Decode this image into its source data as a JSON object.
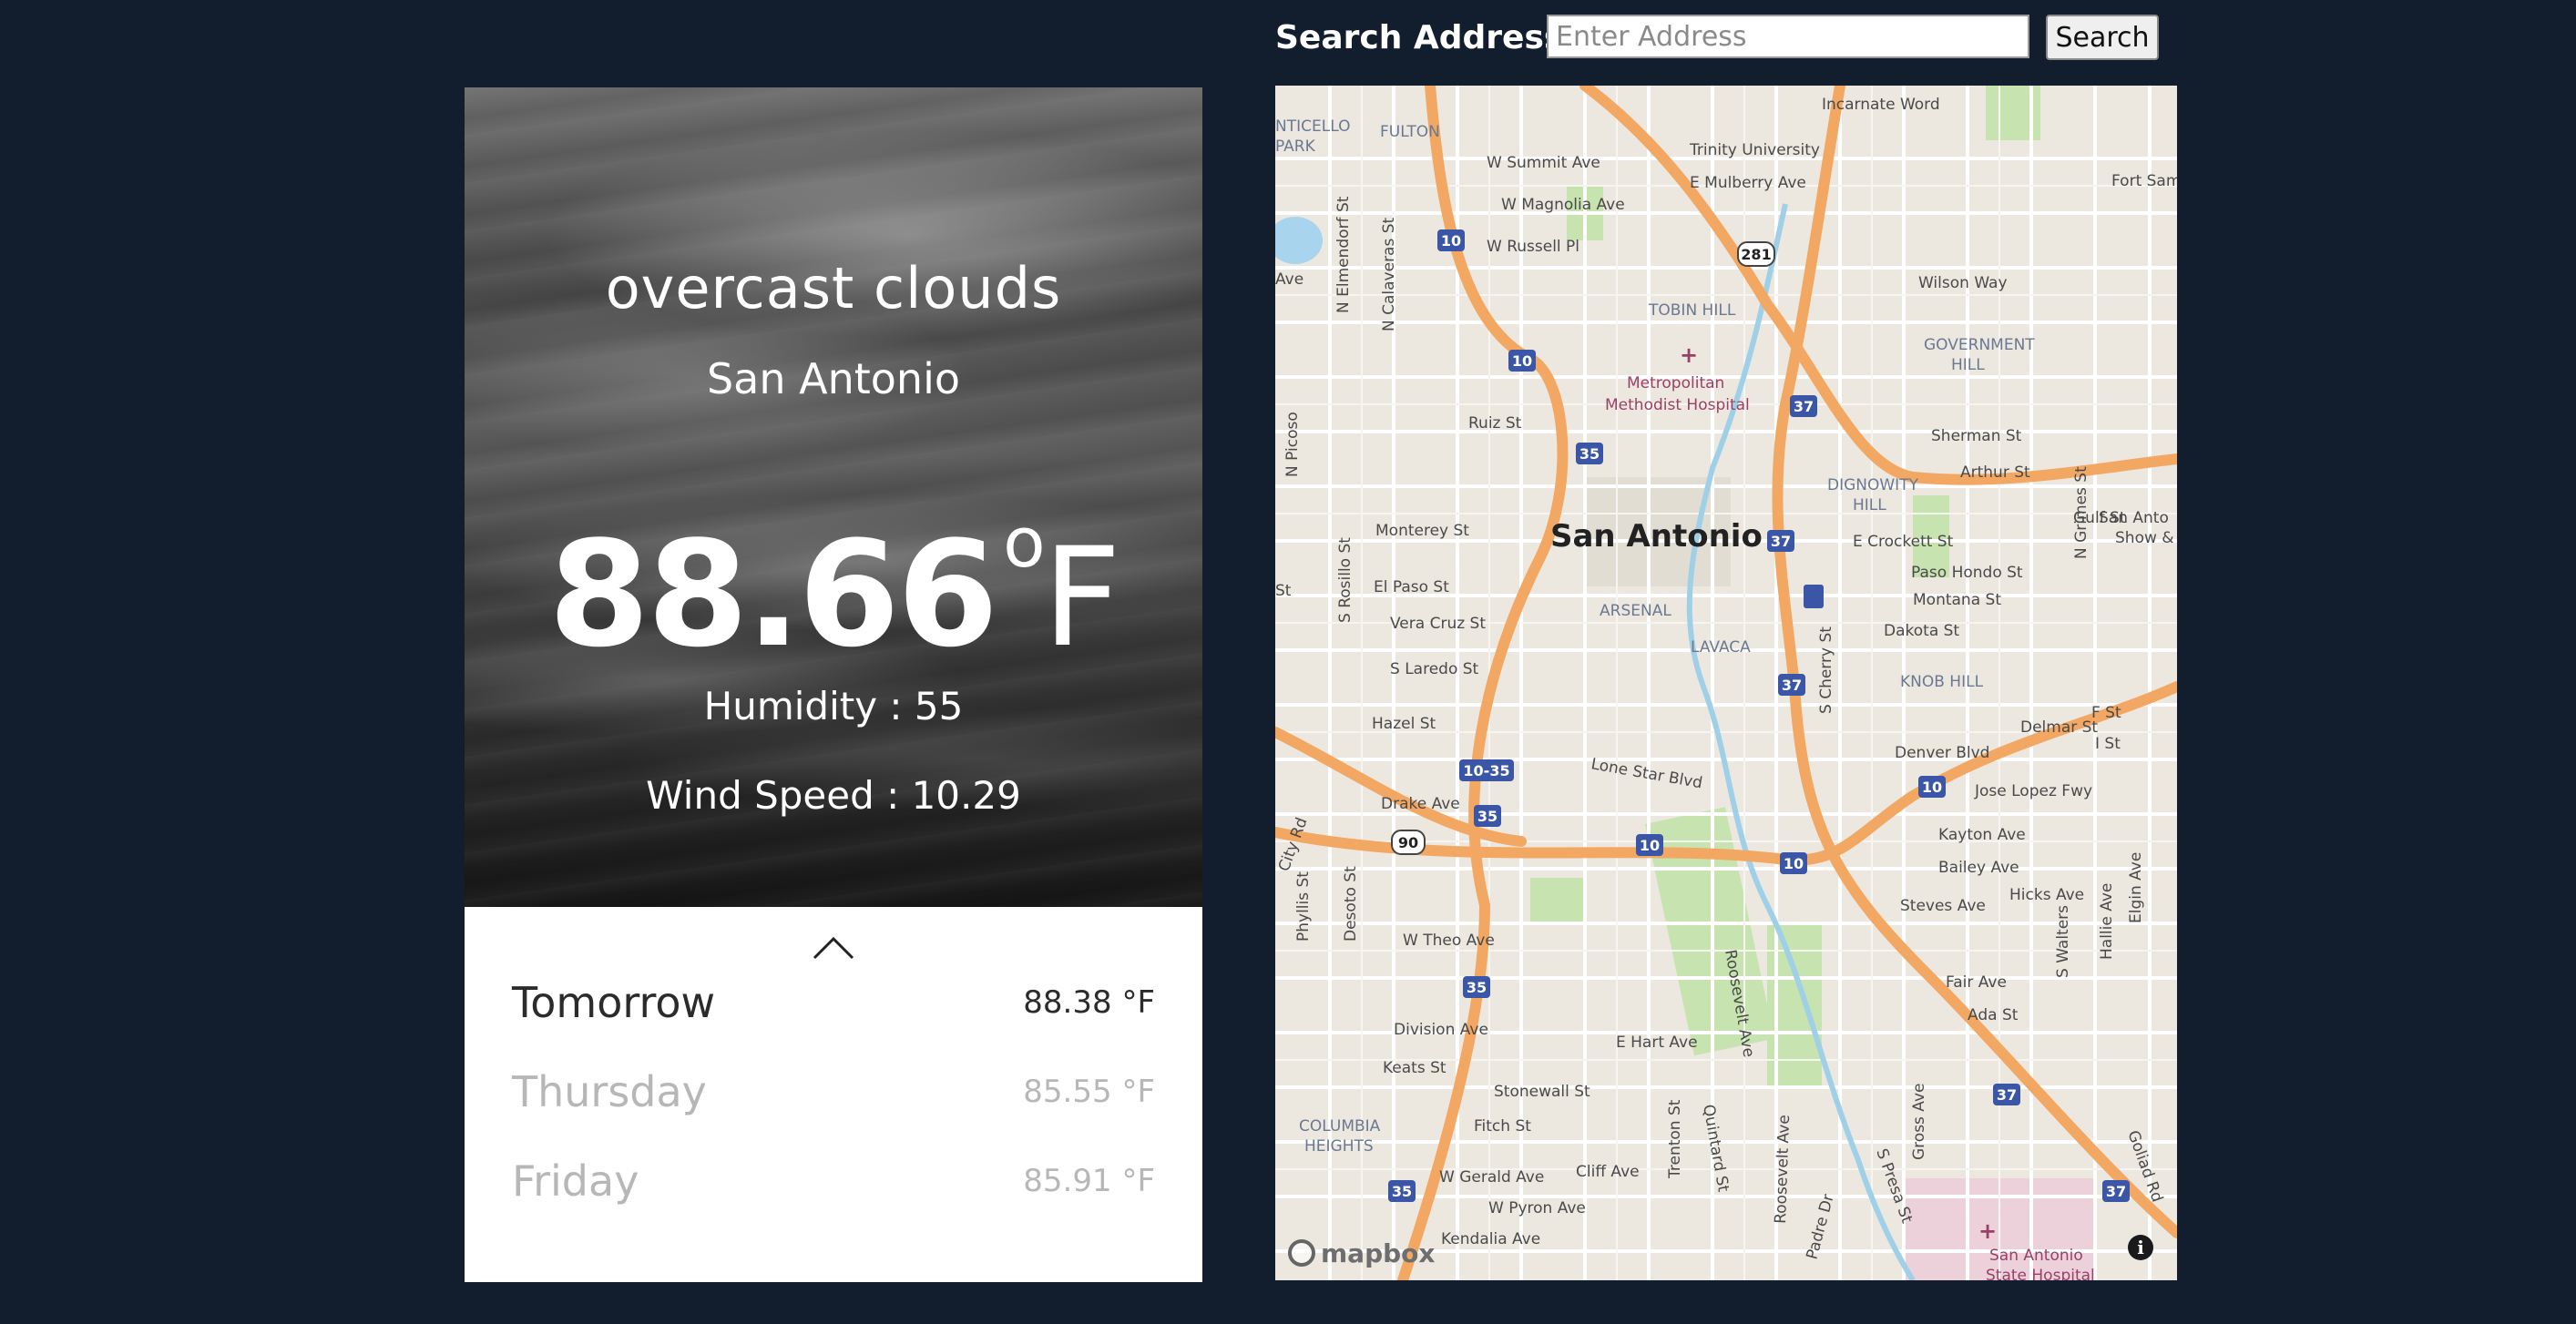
{
  "weather": {
    "description": "overcast clouds",
    "city": "San Antonio",
    "temperature": "88.66",
    "degree_symbol": "o",
    "unit": "F",
    "humidity_text": "Humidity : 55",
    "wind_text": "Wind Speed : 10.29"
  },
  "forecast": [
    {
      "day": "Tomorrow",
      "temp": "88.38",
      "unit": "°F"
    },
    {
      "day": "Thursday",
      "temp": "85.55",
      "unit": "°F"
    },
    {
      "day": "Friday",
      "temp": "85.91",
      "unit": "°F"
    }
  ],
  "search": {
    "label": "Search Address:",
    "placeholder": "Enter Address",
    "button_label": "Search"
  },
  "map": {
    "city_label": "San Antonio",
    "attribution": "mapbox",
    "info_symbol": "i",
    "places": [
      "Incarnate Word",
      "Trinity University",
      "Fort Sam",
      "FULTON",
      "PARK",
      "NTICELLO",
      "W Summit Ave",
      "E Mulberry Ave",
      "W Magnolia Ave",
      "W Russell Pl",
      "Wilson Way",
      "TOBIN HILL",
      "GOVERNMENT",
      "HILL",
      "Metropolitan",
      "Methodist Hospital",
      "Ruiz St",
      "Sherman St",
      "Arthur St",
      "DIGNOWITY",
      "HILL",
      "Gulf St",
      "Monterey St",
      "E Crockett St",
      "Paso Hondo St",
      "San Anto",
      "Show &",
      "El Paso St",
      "ARSENAL",
      "Montana St",
      "Vera Cruz St",
      "LAVACA",
      "Dakota St",
      "S Laredo St",
      "KNOB HILL",
      "Hazel St",
      "Delmar St",
      "F St",
      "Lone Star Blvd",
      "Denver Blvd",
      "I St",
      "Jose Lopez Fwy",
      "Drake Ave",
      "Kayton Ave",
      "Bailey Ave",
      "Hicks Ave",
      "Steves Ave",
      "W Theo Ave",
      "Fair Ave",
      "Ada St",
      "Division Ave",
      "E Hart Ave",
      "Keats St",
      "Stonewall St",
      "Fitch St",
      "COLUMBIA",
      "HEIGHTS",
      "W Gerald Ave",
      "Cliff Ave",
      "W Pyron Ave",
      "Kendalia Ave",
      "San Antonio",
      "State Hospital",
      "N Elmendorf St",
      "N Calaveras St",
      "N Picoso",
      "S Rosillo St",
      "Phyllis St",
      "Desoto St",
      "S Cherry St",
      "Roosevelt Ave",
      "Quintard St",
      "Trenton St",
      "Padre Dr",
      "S Presa St",
      "Gross Ave",
      "S Walters",
      "Hallie Ave",
      "Elgin Ave",
      "Goliad Rd",
      "N Grimes St",
      "City Rd",
      "Ave",
      "St"
    ],
    "shields": [
      "10",
      "281",
      "10",
      "37",
      "35",
      "37",
      "37",
      "10-35",
      "35",
      "90",
      "10",
      "10",
      "10",
      "35",
      "37",
      "35",
      "37"
    ]
  }
}
